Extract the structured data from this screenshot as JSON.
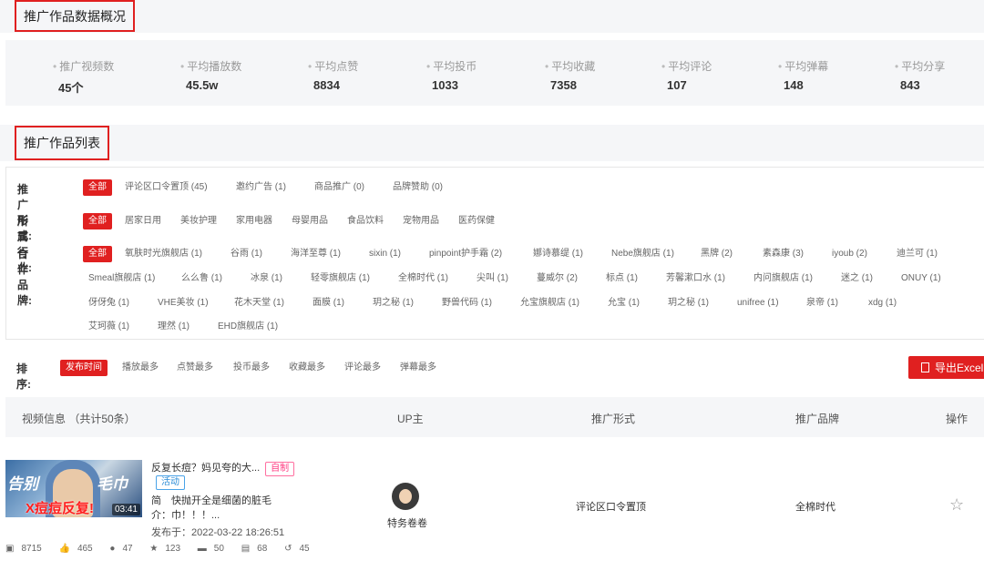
{
  "overview": {
    "title": "推广作品数据概况",
    "stats": [
      {
        "label": "推广视频数",
        "value": "45个"
      },
      {
        "label": "平均播放数",
        "value": "45.5w"
      },
      {
        "label": "平均点赞",
        "value": "8834"
      },
      {
        "label": "平均投币",
        "value": "1033"
      },
      {
        "label": "平均收藏",
        "value": "7358"
      },
      {
        "label": "平均评论",
        "value": "107"
      },
      {
        "label": "平均弹幕",
        "value": "148"
      },
      {
        "label": "平均分享",
        "value": "843"
      }
    ]
  },
  "list": {
    "title": "推广作品列表",
    "filters": {
      "form": {
        "label": "推广形式:",
        "options": [
          "全部",
          "评论区口令置顶 (45)",
          "邀约广告 (1)",
          "商品推广 (0)",
          "品牌赞助 (0)"
        ]
      },
      "industry": {
        "label": "所属行业:",
        "options": [
          "全部",
          "居家日用",
          "美妆护理",
          "家用电器",
          "母婴用品",
          "食品饮料",
          "宠物用品",
          "医药保健"
        ]
      },
      "brand": {
        "label": "合作品牌:",
        "options": [
          "全部",
          "氧肤时光旗舰店 (1)",
          "谷雨 (1)",
          "海洋至尊 (1)",
          "sixin (1)",
          "pinpoint护手霜 (2)",
          "娜诗慕缇 (1)",
          "Nebe旗舰店 (1)",
          "黑牌 (2)",
          "素森康 (3)",
          "iyoub (2)",
          "迪兰可 (1)",
          "Smeal旗舰店 (1)",
          "么么鲁 (1)",
          "冰泉 (1)",
          "轻零旗舰店 (1)",
          "全棉时代 (1)",
          "尖叫 (1)",
          "蔓威尔 (2)",
          "标点 (1)",
          "芳馨漱口水 (1)",
          "内问旗舰店 (1)",
          "迷之 (1)",
          "ONUY (1)",
          "伢伢兔 (1)",
          "VHE美妆 (1)",
          "花木天堂 (1)",
          "面膜 (1)",
          "玥之秘 (1)",
          "野兽代码 (1)",
          "允宝旗舰店 (1)",
          "允宝 (1)",
          "玥之秘 (1)",
          "unifree (1)",
          "泉帝 (1)",
          "xdg (1)",
          "艾珂薇 (1)",
          "理然 (1)",
          "EHD旗舰店 (1)"
        ]
      }
    },
    "sort": {
      "label": "排序:",
      "options": [
        "发布时间",
        "播放最多",
        "点赞最多",
        "投币最多",
        "收藏最多",
        "评论最多",
        "弹幕最多"
      ]
    },
    "export_label": "导出Excel",
    "table": {
      "headers": [
        "视频信息 （共计50条）",
        "UP主",
        "推广形式",
        "推广品牌",
        "操作"
      ],
      "rows": [
        {
          "thumb_text_left": "告别",
          "thumb_text_right": "毛巾",
          "thumb_text_bottom": "X痘痘反复!",
          "duration": "03:41",
          "title": "反复长痘？妈见夸的大...",
          "tag_self": "自制",
          "tag_activity": "活动",
          "desc_line1": "简　快抛开全是细菌的脏毛",
          "desc_line2": "介：巾！！！...",
          "published": "发布于：2022-03-22 18:26:51",
          "up_name": "特务卷卷",
          "form": "评论区口令置顶",
          "brand": "全棉时代",
          "metrics": [
            "8715",
            "465",
            "47",
            "123",
            "50",
            "68",
            "45"
          ]
        }
      ]
    }
  },
  "colors": {
    "accent": "#e02020",
    "panel_bg": "#f5f6f8"
  }
}
